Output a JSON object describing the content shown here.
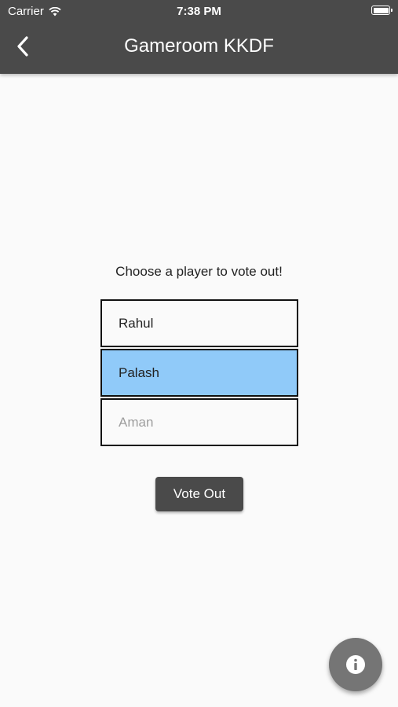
{
  "status_bar": {
    "carrier": "Carrier",
    "time": "7:38 PM"
  },
  "app_bar": {
    "title": "Gameroom KKDF",
    "back_icon": "chevron-left-icon"
  },
  "main": {
    "prompt": "Choose a player to vote out!",
    "players": [
      {
        "name": "Rahul",
        "state": "default"
      },
      {
        "name": "Palash",
        "state": "selected"
      },
      {
        "name": "Aman",
        "state": "disabled"
      }
    ],
    "vote_button_label": "Vote Out"
  },
  "fab": {
    "icon": "info-icon"
  },
  "colors": {
    "app_bar": "#4a4a4a",
    "selected_row": "#90caf9",
    "fab": "#757575",
    "background": "#fafafa"
  }
}
